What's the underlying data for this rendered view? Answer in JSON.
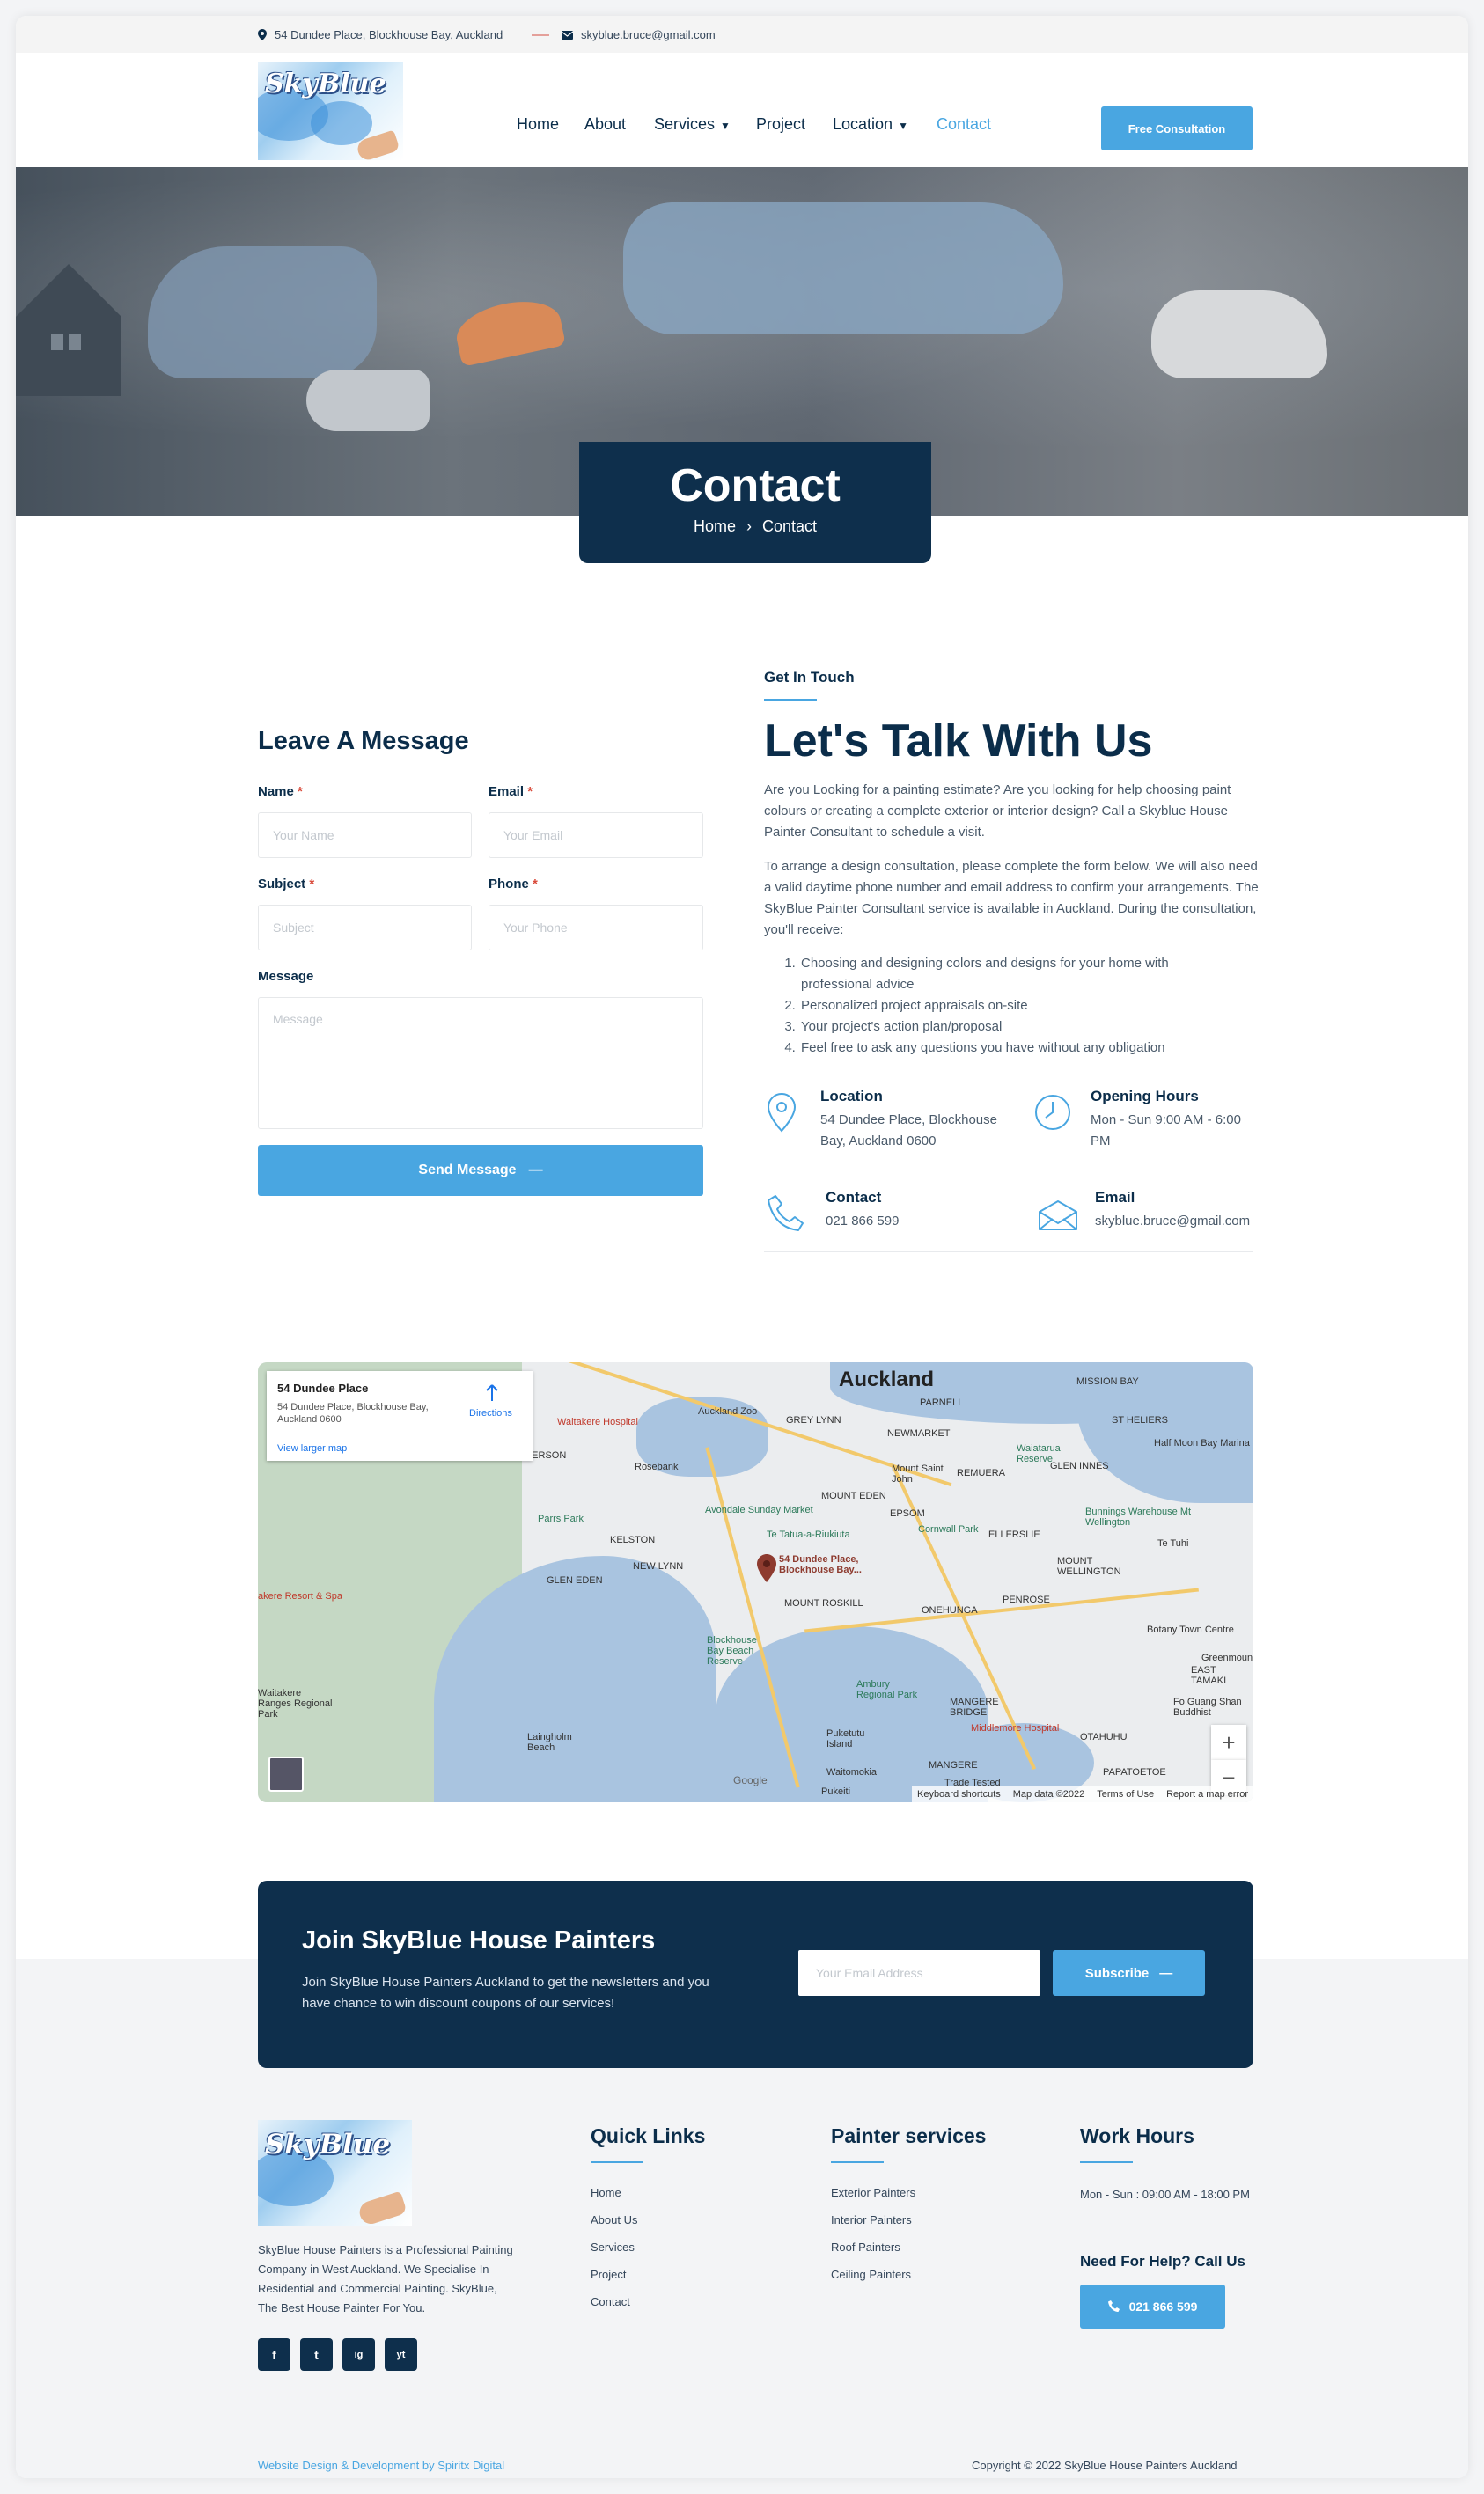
{
  "topbar": {
    "address": "54 Dundee Place, Blockhouse Bay, Auckland",
    "email": "skyblue.bruce@gmail.com"
  },
  "header": {
    "logo_text": "SkyBlue",
    "nav": [
      {
        "label": "Home"
      },
      {
        "label": "About"
      },
      {
        "label": "Services"
      },
      {
        "label": "Project"
      },
      {
        "label": "Location"
      },
      {
        "label": "Contact"
      }
    ],
    "cta": "Free Consultation",
    "active_color": "#49a6e1"
  },
  "hero": {
    "title": "Contact",
    "breadcrumb_home": "Home",
    "breadcrumb_current": "Contact"
  },
  "form": {
    "heading": "Leave A Message",
    "name_label": "Name",
    "name_placeholder": "Your Name",
    "email_label": "Email",
    "email_placeholder": "Your Email",
    "subject_label": "Subject",
    "subject_placeholder": "Subject",
    "phone_label": "Phone",
    "phone_placeholder": "Your Phone",
    "message_label": "Message",
    "message_placeholder": "Message",
    "required_mark": "*",
    "submit": "Send Message"
  },
  "intro": {
    "eyebrow": "Get In Touch",
    "heading": "Let's Talk With Us",
    "para1": "Are you Looking for a painting estimate? Are you looking for help choosing paint colours or creating a complete exterior or interior design? Call a Skyblue House Painter Consultant to schedule a visit.",
    "para2": "To arrange a design consultation, please complete the form below. We will also need a valid daytime phone number and email address to confirm your arrangements. The SkyBlue Painter Consultant service is available in Auckland. During the consultation, you'll receive:",
    "list": [
      "Choosing and designing colors and designs for your home with professional advice",
      "Personalized project appraisals on-site",
      "Your project's action plan/proposal",
      "Feel free to ask any questions you have without any obligation"
    ]
  },
  "info": {
    "location_title": "Location",
    "location_text": "54 Dundee Place, Blockhouse Bay, Auckland 0600",
    "hours_title": "Opening Hours",
    "hours_text": "Mon - Sun 9:00 AM - 6:00 PM",
    "contact_title": "Contact",
    "contact_text": "021 866 599",
    "email_title": "Email",
    "email_text": "skyblue.bruce@gmail.com"
  },
  "map": {
    "card_title": "54 Dundee Place",
    "card_address": "54 Dundee Place, Blockhouse Bay, Auckland 0600",
    "directions": "Directions",
    "larger_map": "View larger map",
    "city": "Auckland",
    "pin_label": "54 Dundee Place, Blockhouse Bay...",
    "labels": [
      "PARNELL",
      "GREY LYNN",
      "NEWMARKET",
      "Auckland Zoo",
      "Waitakere Hospital",
      "HENDERSON",
      "Rosebank",
      "REMUERA",
      "Mount Saint John",
      "MOUNT EDEN",
      "Avondale Sunday Market",
      "EPSOM",
      "Cornwall Park",
      "ELLERSLIE",
      "Te Tatua-a-Riukiuta",
      "Parrs Park",
      "KELSTON",
      "NEW LYNN",
      "GLEN EDEN",
      "MOUNT ROSKILL",
      "ONEHUNGA",
      "PENROSE",
      "MOUNT WELLINGTON",
      "Waiatarua Reserve",
      "Half Moon Bay Marina",
      "Bunnings Warehouse Mt Wellington",
      "GLEN INNES",
      "MISSION BAY",
      "ST HELIERS",
      "Te Tuhi",
      "Botany Town Centre",
      "Greenmount",
      "EAST TAMAKI",
      "Blockhouse Bay Beach Reserve",
      "Ambury Regional Park",
      "MANGERE BRIDGE",
      "Middlemore Hospital",
      "OTAHUHU",
      "Puketutu Island",
      "MANGERE",
      "Laingholm Beach",
      "Waitakere Ranges Regional Park",
      "akere Resort & Spa",
      "PAPATOETOE",
      "Waitomokia",
      "Pukeiti",
      "Trade Tested",
      "Fo Guang Shan Buddhist"
    ],
    "footer_items": [
      "Keyboard shortcuts",
      "Map data ©2022",
      "Terms of Use",
      "Report a map error"
    ],
    "google": "Google",
    "zoom_in": "+",
    "zoom_out": "−"
  },
  "newsletter": {
    "title": "Join SkyBlue House Painters",
    "text": "Join SkyBlue House Painters Auckland to get the newsletters and you have chance to win discount coupons of our services!",
    "placeholder": "Your Email Address",
    "button": "Subscribe"
  },
  "footer": {
    "logo_text": "SkyBlue",
    "about": "SkyBlue House Painters is a Professional Painting Company in West Auckland. We Specialise In Residential and Commercial Painting. SkyBlue, The Best House Painter For You.",
    "social": [
      "f",
      "t",
      "ig",
      "yt"
    ],
    "quick_title": "Quick Links",
    "quick_links": [
      "Home",
      "About Us",
      "Services",
      "Project",
      "Contact"
    ],
    "services_title": "Painter services",
    "services": [
      "Exterior Painters",
      "Interior Painters",
      "Roof Painters",
      "Ceiling Painters"
    ],
    "hours_title": "Work Hours",
    "hours": "Mon - Sun : 09:00 AM - 18:00 PM",
    "help_title": "Need For Help? Call Us",
    "phone": "021 866 599",
    "credit": "Website Design & Development by Spiritx Digital",
    "copyright": "Copyright © 2022 SkyBlue House Painters Auckland"
  }
}
